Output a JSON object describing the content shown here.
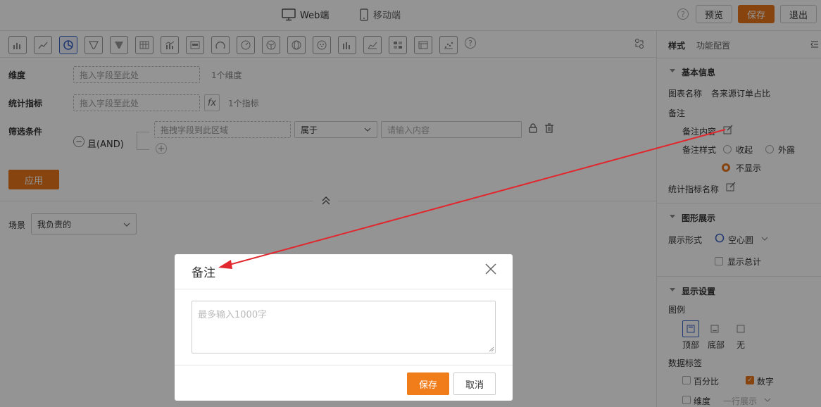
{
  "topbar": {
    "web_label": "Web端",
    "mobile_label": "移动端",
    "preview": "预览",
    "save": "保存",
    "exit": "退出",
    "help": "?"
  },
  "query": {
    "dimension_label": "维度",
    "dimension_placeholder": "拖入字段至此处",
    "dimension_count": "1个维度",
    "metric_label": "统计指标",
    "metric_placeholder": "拖入字段至此处",
    "fx": "fx",
    "metric_count": "1个指标",
    "filter_label": "筛选条件",
    "and_label": "且(AND)",
    "filter_field_placeholder": "拖拽字段到此区域",
    "operator": "属于",
    "value_placeholder": "请输入内容",
    "apply": "应用"
  },
  "scene": {
    "label": "场景",
    "value": "我负责的"
  },
  "panel": {
    "tab_style": "样式",
    "tab_function": "功能配置",
    "basic_info": "基本信息",
    "chart_name_label": "图表名称",
    "chart_name_value": "各来源订单占比",
    "note_label": "备注",
    "note_content_label": "备注内容",
    "note_style_label": "备注样式",
    "opt_collapse": "收起",
    "opt_expose": "外露",
    "opt_hide": "不显示",
    "metric_name_label": "统计指标名称",
    "graphic_section": "图形展示",
    "display_form_label": "展示形式",
    "display_form_value": "空心圆",
    "show_total": "显示总计",
    "display_section": "显示设置",
    "legend_label": "图例",
    "legend_top": "顶部",
    "legend_bottom": "底部",
    "legend_none": "无",
    "data_label": "数据标签",
    "percent": "百分比",
    "number": "数字",
    "dimension": "维度",
    "one_line": "一行展示"
  },
  "modal": {
    "title": "备注",
    "placeholder": "最多输入1000字",
    "save": "保存",
    "cancel": "取消"
  },
  "colors": {
    "accent": "#e8761b",
    "selected_icon": "#3d66c4",
    "arrow": "#e0282e"
  }
}
